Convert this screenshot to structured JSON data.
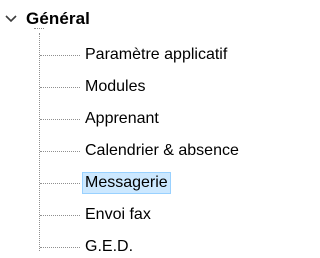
{
  "tree": {
    "root": {
      "label": "Général",
      "expanded": true
    },
    "children": [
      {
        "label": "Paramètre applicatif",
        "selected": false
      },
      {
        "label": "Modules",
        "selected": false
      },
      {
        "label": "Apprenant",
        "selected": false
      },
      {
        "label": "Calendrier & absence",
        "selected": false
      },
      {
        "label": "Messagerie",
        "selected": true
      },
      {
        "label": "Envoi fax",
        "selected": false
      },
      {
        "label": "G.E.D.",
        "selected": false
      }
    ]
  },
  "colors": {
    "selection_bg": "#cce8ff",
    "selection_border": "#99d1ff",
    "guide_lines": "#8f8f8f"
  },
  "icons": {
    "expander": "chevron-down-icon"
  }
}
